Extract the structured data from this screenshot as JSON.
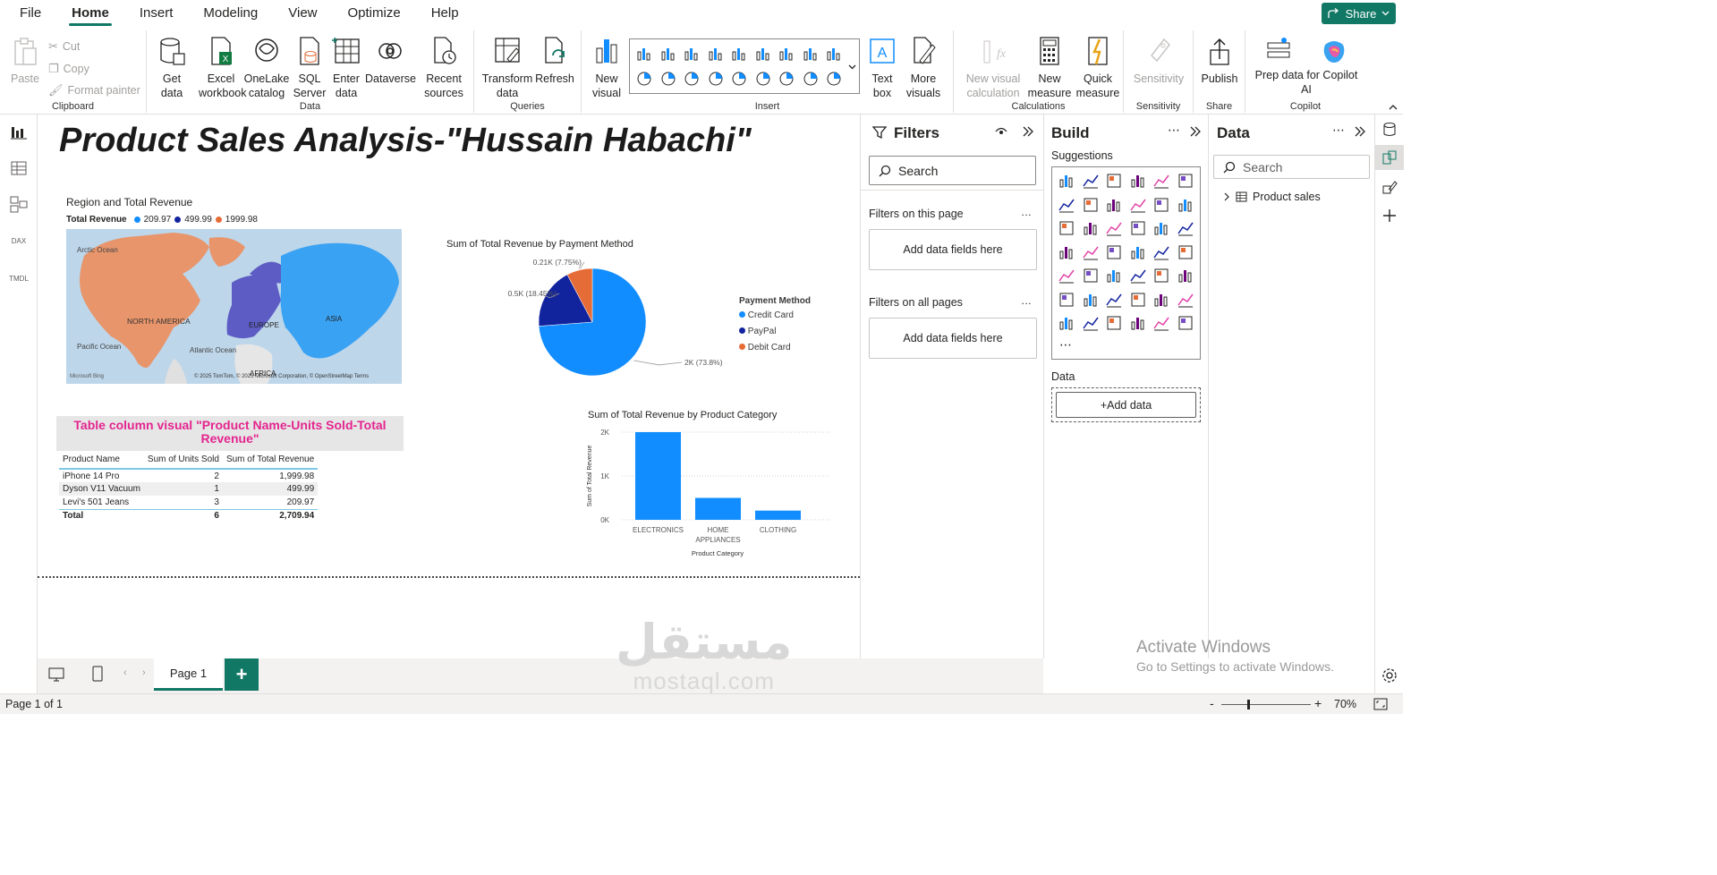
{
  "menu": [
    "File",
    "Home",
    "Insert",
    "Modeling",
    "View",
    "Optimize",
    "Help"
  ],
  "share_label": "Share",
  "ribbon": {
    "clipboard": {
      "paste": "Paste",
      "cut": "Cut",
      "copy": "Copy",
      "format_painter": "Format painter",
      "group": "Clipboard"
    },
    "data": {
      "get_data": "Get data",
      "excel": "Excel workbook",
      "onelake": "OneLake catalog",
      "sql": "SQL Server",
      "enter": "Enter data",
      "dataverse": "Dataverse",
      "recent": "Recent sources",
      "group": "Data"
    },
    "queries": {
      "transform": "Transform data",
      "refresh": "Refresh",
      "group": "Queries"
    },
    "insert": {
      "new_visual": "New visual",
      "text_box": "Text box",
      "more_visuals": "More visuals",
      "group": "Insert"
    },
    "calculations": {
      "new_visual_calc": "New visual calculation",
      "new_measure": "New measure",
      "quick_measure": "Quick measure",
      "group": "Calculations"
    },
    "sensitivity": {
      "label": "Sensitivity",
      "group": "Sensitivity"
    },
    "share": {
      "publish": "Publish",
      "group": "Share"
    },
    "copilot": {
      "prep": "Prep data for Copilot AI",
      "group": "Copilot"
    }
  },
  "leftnav_labels": {
    "dax": "DAX",
    "tmdl": "TMDL"
  },
  "report": {
    "title": "Product Sales Analysis-\"Hussain Habachi\"",
    "map": {
      "title": "Region and Total Revenue",
      "legend_title": "Total Revenue",
      "legend": [
        {
          "label": "209.97",
          "color": "#118dff"
        },
        {
          "label": "499.99",
          "color": "#12239e"
        },
        {
          "label": "1999.98",
          "color": "#e66c37"
        }
      ],
      "labels": {
        "arctic": "Arctic Ocean",
        "na": "NORTH AMERICA",
        "europe": "EUROPE",
        "asia": "ASIA",
        "pacific": "Pacific Ocean",
        "atlantic": "Atlantic Ocean",
        "africa": "AFRICA",
        "bing": "Microsoft Bing",
        "copyright": "© 2025 TomTom, © 2025 Microsoft Corporation, © OpenStreetMap  Terms"
      }
    },
    "table": {
      "title": "Table column visual \"Product Name-Units Sold-Total Revenue\"",
      "headers": [
        "Product Name",
        "Sum of Units Sold",
        "Sum of Total Revenue"
      ],
      "rows": [
        [
          "iPhone 14 Pro",
          "2",
          "1,999.98"
        ],
        [
          "Dyson V11 Vacuum",
          "1",
          "499.99"
        ],
        [
          "Levi's 501 Jeans",
          "3",
          "209.97"
        ]
      ],
      "total": [
        "Total",
        "6",
        "2,709.94"
      ]
    },
    "pie": {
      "title": "Sum of Total Revenue by Payment Method",
      "legend_title": "Payment Method",
      "slices": [
        {
          "name": "Credit Card",
          "value": 2000,
          "label": "2K (73.8%)",
          "color": "#118dff"
        },
        {
          "name": "PayPal",
          "value": 500,
          "label": "0.5K (18.45%)",
          "color": "#12239e"
        },
        {
          "name": "Debit Card",
          "value": 210,
          "label": "0.21K (7.75%)",
          "color": "#e66c37"
        }
      ]
    },
    "bar": {
      "title": "Sum of Total Revenue by Product Category",
      "ylabel": "Sum of Total Revenue",
      "xlabel": "Product Category",
      "yticks": [
        "0K",
        "1K",
        "2K"
      ],
      "categories": [
        "ELECTRONICS",
        "HOME APPLIANCES",
        "CLOTHING"
      ],
      "values": [
        2000,
        500,
        210
      ],
      "color": "#118dff"
    }
  },
  "chart_data": [
    {
      "type": "pie",
      "title": "Sum of Total Revenue by Payment Method",
      "categories": [
        "Credit Card",
        "PayPal",
        "Debit Card"
      ],
      "values": [
        2000,
        500,
        210
      ],
      "legend": "right"
    },
    {
      "type": "bar",
      "title": "Sum of Total Revenue by Product Category",
      "categories": [
        "ELECTRONICS",
        "HOME APPLIANCES",
        "CLOTHING"
      ],
      "values": [
        2000,
        500,
        210
      ],
      "xlabel": "Product Category",
      "ylabel": "Sum of Total Revenue",
      "ylim": [
        0,
        2000
      ],
      "grid": true
    }
  ],
  "filters": {
    "title": "Filters",
    "search": "Search",
    "on_page": "Filters on this page",
    "on_all": "Filters on all pages",
    "add_fields": "Add data fields here"
  },
  "build": {
    "title": "Build",
    "suggestions": "Suggestions",
    "data_label": "Data",
    "add_data": "+Add data"
  },
  "data_pane": {
    "title": "Data",
    "search": "Search",
    "table": "Product sales"
  },
  "pages": {
    "tab": "Page 1",
    "add": "+"
  },
  "status": {
    "page": "Page 1 of 1",
    "zoom": "70%"
  },
  "activate": {
    "line1": "Activate Windows",
    "line2": "Go to Settings to activate Windows."
  },
  "watermark": {
    "arabic": "مستقل",
    "latin": "mostaql.com"
  }
}
